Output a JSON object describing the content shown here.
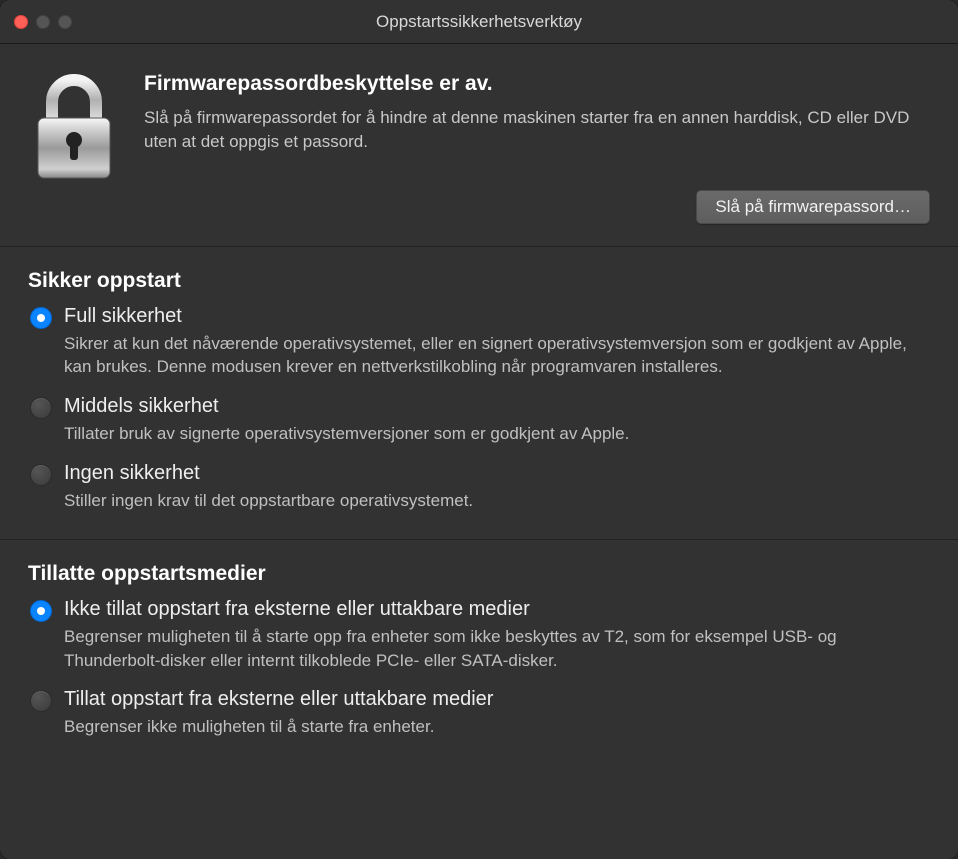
{
  "window": {
    "title": "Oppstartssikkerhetsverktøy"
  },
  "firmware": {
    "heading": "Firmwarepassordbeskyttelse er av.",
    "description": "Slå på firmwarepassordet for å hindre at denne maskinen starter fra en annen harddisk, CD eller DVD uten at det oppgis et passord.",
    "button_label": "Slå på firmwarepassord…"
  },
  "secure_boot": {
    "heading": "Sikker oppstart",
    "options": [
      {
        "label": "Full sikkerhet",
        "description": "Sikrer at kun det nåværende operativsystemet, eller en signert operativsystemversjon som er godkjent av Apple, kan brukes. Denne modusen krever en nettverkstilkobling når programvaren installeres.",
        "selected": true
      },
      {
        "label": "Middels sikkerhet",
        "description": "Tillater bruk av signerte operativsystemversjoner som er godkjent av Apple.",
        "selected": false
      },
      {
        "label": "Ingen sikkerhet",
        "description": "Stiller ingen krav til det oppstartbare operativsystemet.",
        "selected": false
      }
    ]
  },
  "boot_media": {
    "heading": "Tillatte oppstartsmedier",
    "options": [
      {
        "label": "Ikke tillat oppstart fra eksterne eller uttakbare medier",
        "description": "Begrenser muligheten til å starte opp fra enheter som ikke beskyttes av T2, som for eksempel USB- og Thunderbolt-disker eller internt tilkoblede PCIe- eller SATA-disker.",
        "selected": true
      },
      {
        "label": "Tillat oppstart fra eksterne eller uttakbare medier",
        "description": "Begrenser ikke muligheten til å starte fra enheter.",
        "selected": false
      }
    ]
  }
}
